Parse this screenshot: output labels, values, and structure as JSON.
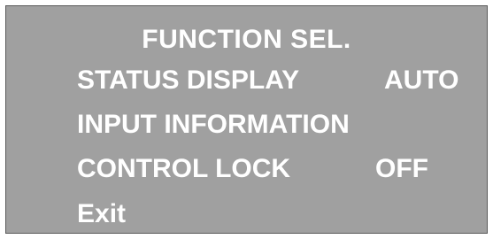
{
  "menu": {
    "title": "FUNCTION SEL.",
    "items": [
      {
        "label": "STATUS DISPLAY",
        "value": "AUTO"
      },
      {
        "label": "INPUT INFORMATION",
        "value": ""
      },
      {
        "label": "CONTROL LOCK",
        "value": "OFF"
      },
      {
        "label": "Exit",
        "value": ""
      }
    ]
  },
  "colors": {
    "panel_background": "#a0a0a0",
    "text": "#ffffff"
  }
}
